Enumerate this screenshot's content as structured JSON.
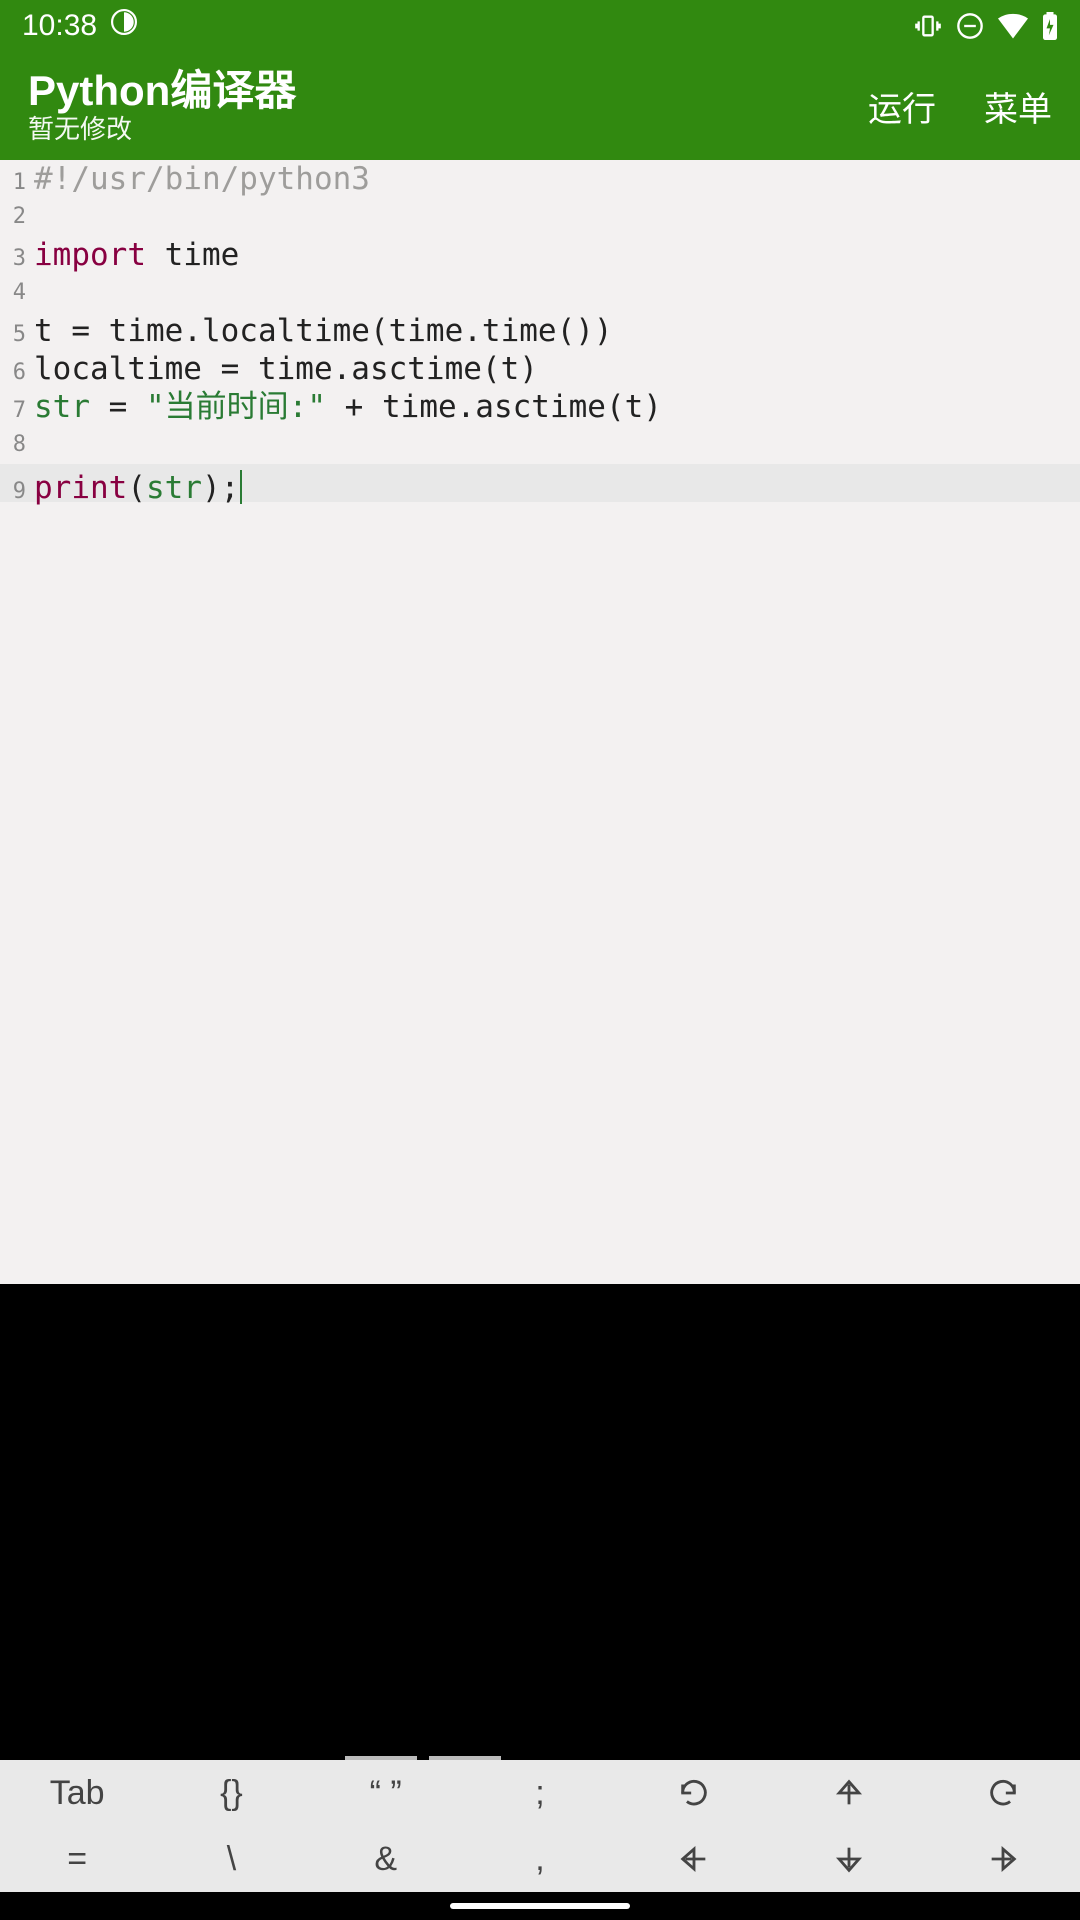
{
  "status": {
    "time": "10:38"
  },
  "app": {
    "title": "Python编译器",
    "subtitle": "暂无修改",
    "actions": {
      "run": "运行",
      "menu": "菜单"
    }
  },
  "code": {
    "lines": [
      {
        "n": "1",
        "tokens": [
          {
            "c": "comment",
            "t": "#!/usr/bin/python3"
          }
        ]
      },
      {
        "n": "2",
        "tokens": []
      },
      {
        "n": "3",
        "tokens": [
          {
            "c": "keyword",
            "t": "import"
          },
          {
            "c": "default",
            "t": " time"
          }
        ]
      },
      {
        "n": "4",
        "tokens": []
      },
      {
        "n": "5",
        "tokens": [
          {
            "c": "default",
            "t": "t = time.localtime(time.time())"
          }
        ]
      },
      {
        "n": "6",
        "tokens": [
          {
            "c": "default",
            "t": "localtime = time.asctime(t)"
          }
        ]
      },
      {
        "n": "7",
        "tokens": [
          {
            "c": "builtin",
            "t": "str"
          },
          {
            "c": "default",
            "t": " = "
          },
          {
            "c": "string",
            "t": "\"当前时间:\""
          },
          {
            "c": "default",
            "t": " + time.asctime(t)"
          }
        ]
      },
      {
        "n": "8",
        "tokens": []
      },
      {
        "n": "9",
        "active": true,
        "tokens": [
          {
            "c": "keyword",
            "t": "print"
          },
          {
            "c": "default",
            "t": "("
          },
          {
            "c": "builtin",
            "t": "str"
          },
          {
            "c": "default",
            "t": ");"
          }
        ],
        "cursor": true
      }
    ]
  },
  "symrows": [
    [
      {
        "id": "tab",
        "label": "Tab"
      },
      {
        "id": "braces",
        "label": "{}"
      },
      {
        "id": "quotes",
        "label": "“ ”"
      },
      {
        "id": "semicolon",
        "label": ";"
      },
      {
        "id": "undo",
        "icon": "undo"
      },
      {
        "id": "up",
        "icon": "arrow-up"
      },
      {
        "id": "redo",
        "icon": "redo"
      }
    ],
    [
      {
        "id": "equals",
        "label": "="
      },
      {
        "id": "backslash",
        "label": "\\"
      },
      {
        "id": "ampersand",
        "label": "&"
      },
      {
        "id": "comma",
        "label": ","
      },
      {
        "id": "left",
        "icon": "arrow-left"
      },
      {
        "id": "down",
        "icon": "arrow-down"
      },
      {
        "id": "right",
        "icon": "arrow-right"
      }
    ]
  ]
}
